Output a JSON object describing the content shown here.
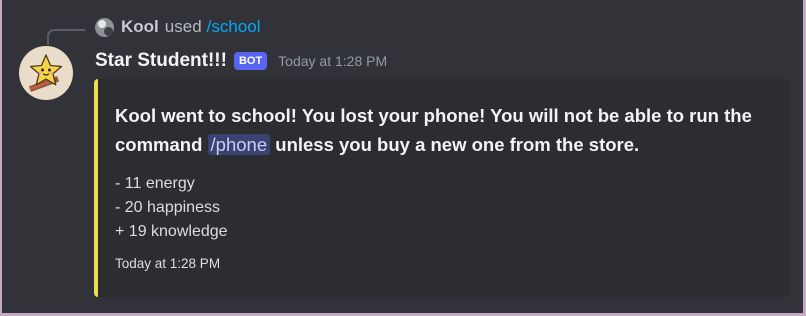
{
  "reply": {
    "user": "Kool",
    "verb": "used",
    "command": "/school"
  },
  "message": {
    "username": "Star Student!!!",
    "badge": "BOT",
    "timestamp": "Today at 1:28 PM"
  },
  "embed": {
    "accent_color": "#f0db4f",
    "title_before": "Kool went to school! You lost your phone! You will not be able to run the command ",
    "title_command": "/phone",
    "title_after": " unless you buy a new one from the store.",
    "stats": [
      "- 11 energy",
      "- 20 happiness",
      "+ 19 knowledge"
    ],
    "footer": "Today at 1:28 PM"
  }
}
